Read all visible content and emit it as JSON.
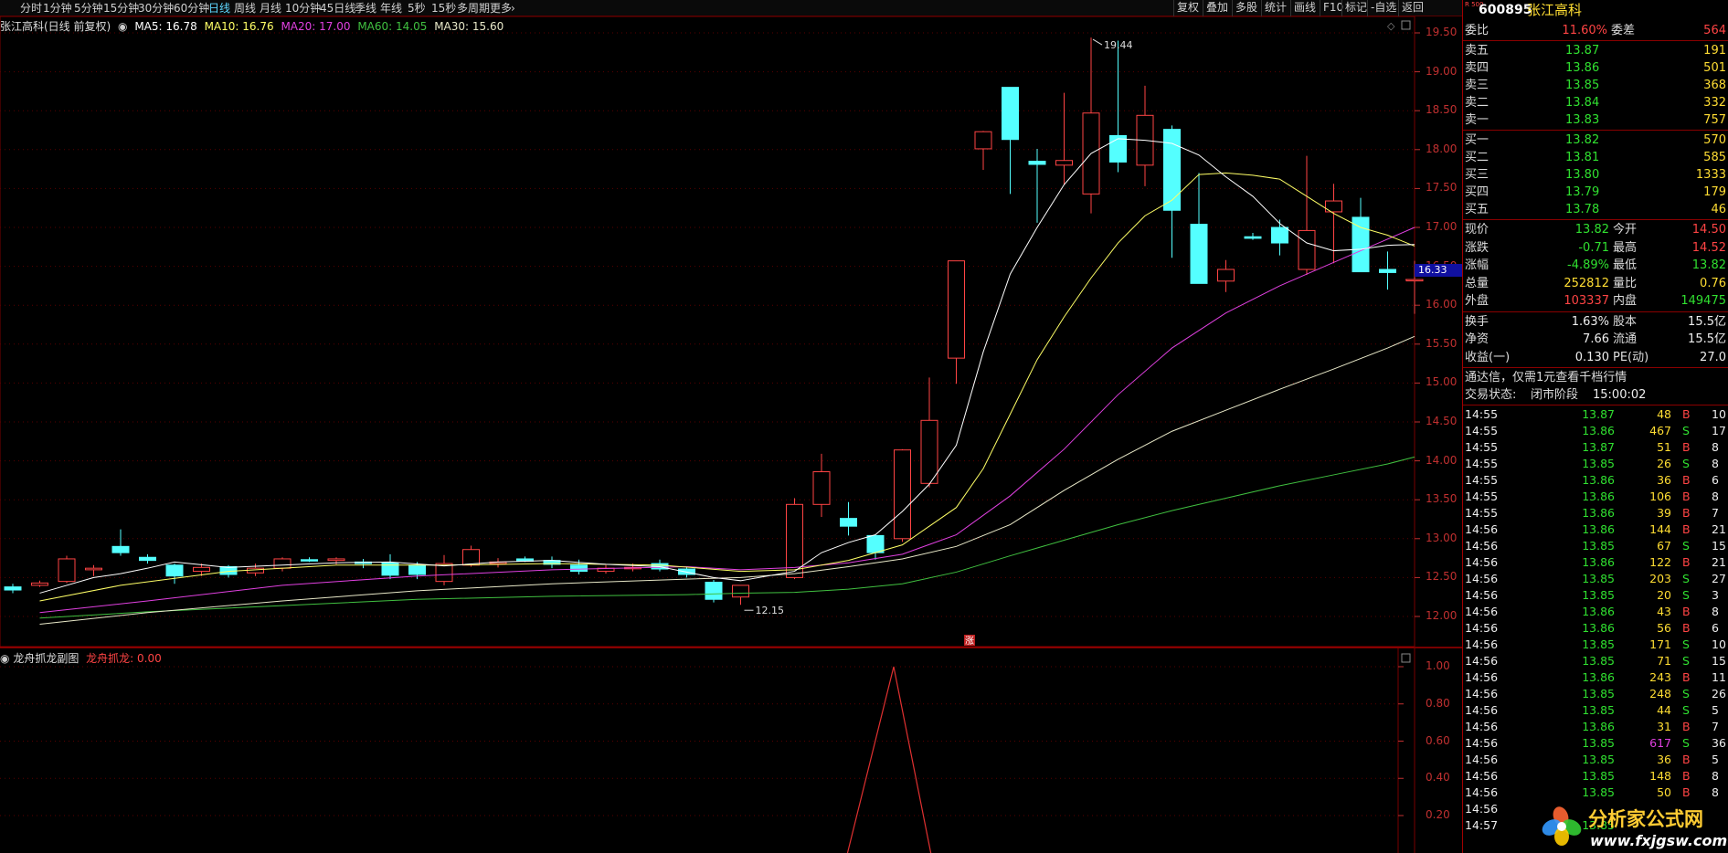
{
  "toolbar": {
    "timeframes": [
      "分时",
      "1分钟",
      "5分钟",
      "15分钟",
      "30分钟",
      "60分钟",
      "日线",
      "周线",
      "月线",
      "10分钟",
      "45日线",
      "季线",
      "年线",
      "5秒",
      "15秒",
      "多周期",
      "更多"
    ],
    "active": "日线",
    "right_buttons": [
      "复权",
      "叠加",
      "多股",
      "统计",
      "画线",
      "F10",
      "标记",
      "-自选",
      "返回"
    ]
  },
  "chart_info": {
    "title": "张江高科(日线 前复权)",
    "ma5": "MA5: 16.78",
    "ma10": "MA10: 16.76",
    "ma20": "MA20: 17.00",
    "ma60": "MA60: 14.05",
    "ma30": "MA30: 15.60",
    "high_label": "19.44",
    "low_label": "12.15",
    "current_tag": "16.33",
    "zhang_mark": "涨",
    "y_labels": [
      "19.50",
      "19.00",
      "18.50",
      "18.00",
      "17.50",
      "17.00",
      "16.50",
      "16.00",
      "15.50",
      "15.00",
      "14.50",
      "14.00",
      "13.50",
      "13.00",
      "12.50",
      "12.00"
    ],
    "colors": {
      "up": "#ff4444",
      "down": "#54ffff",
      "ma5": "#ffffff",
      "ma10": "#ffff66",
      "ma20": "#e040e0",
      "ma30": "#e8e8c8",
      "ma60": "#40c040"
    }
  },
  "sub_chart": {
    "title": "龙舟抓龙副图",
    "series_label": "龙舟抓龙: 0.00",
    "y_labels": [
      "1.00",
      "0.80",
      "0.60",
      "0.40",
      "0.20"
    ]
  },
  "chart_data": {
    "type": "candlestick",
    "ohlc": [
      [
        12.38,
        12.42,
        12.3,
        12.34
      ],
      [
        12.4,
        12.46,
        12.38,
        12.43
      ],
      [
        12.45,
        12.78,
        12.43,
        12.74
      ],
      [
        12.6,
        12.66,
        12.52,
        12.62
      ],
      [
        12.9,
        13.12,
        12.78,
        12.82
      ],
      [
        12.76,
        12.8,
        12.68,
        12.72
      ],
      [
        12.66,
        12.68,
        12.42,
        12.52
      ],
      [
        12.58,
        12.68,
        12.52,
        12.63
      ],
      [
        12.64,
        12.66,
        12.5,
        12.54
      ],
      [
        12.56,
        12.68,
        12.52,
        12.62
      ],
      [
        12.62,
        12.76,
        12.58,
        12.74
      ],
      [
        12.73,
        12.76,
        12.7,
        12.72
      ],
      [
        12.72,
        12.76,
        12.67,
        12.74
      ],
      [
        12.7,
        12.74,
        12.62,
        12.68
      ],
      [
        12.69,
        12.8,
        12.48,
        12.53
      ],
      [
        12.66,
        12.7,
        12.48,
        12.54
      ],
      [
        12.45,
        12.79,
        12.4,
        12.68
      ],
      [
        12.66,
        12.91,
        12.64,
        12.86
      ],
      [
        12.68,
        12.75,
        12.63,
        12.7
      ],
      [
        12.74,
        12.77,
        12.7,
        12.71
      ],
      [
        12.72,
        12.77,
        12.62,
        12.67
      ],
      [
        12.66,
        12.73,
        12.54,
        12.58
      ],
      [
        12.58,
        12.66,
        12.55,
        12.62
      ],
      [
        12.62,
        12.68,
        12.58,
        12.63
      ],
      [
        12.68,
        12.73,
        12.58,
        12.61
      ],
      [
        12.61,
        12.63,
        12.5,
        12.54
      ],
      [
        12.44,
        12.47,
        12.18,
        12.22
      ],
      [
        12.25,
        12.4,
        12.15,
        12.4
      ],
      [
        null,
        null,
        null,
        null
      ],
      [
        12.5,
        13.52,
        12.48,
        13.44
      ],
      [
        13.44,
        14.09,
        13.28,
        13.86
      ],
      [
        13.26,
        13.47,
        13.04,
        13.16
      ],
      [
        13.04,
        13.04,
        12.73,
        12.82
      ],
      [
        13.0,
        14.15,
        12.96,
        14.14
      ],
      [
        13.71,
        15.07,
        13.66,
        14.52
      ],
      [
        15.32,
        16.57,
        14.99,
        16.57
      ],
      [
        18.01,
        18.24,
        17.74,
        18.23
      ],
      [
        18.8,
        18.8,
        17.43,
        18.13
      ],
      [
        17.85,
        18.01,
        17.06,
        17.81
      ],
      [
        17.8,
        18.73,
        17.55,
        17.86
      ],
      [
        17.43,
        19.44,
        17.18,
        18.47
      ],
      [
        18.18,
        19.4,
        17.71,
        17.84
      ],
      [
        17.8,
        18.82,
        17.53,
        18.44
      ],
      [
        18.26,
        18.31,
        16.61,
        17.22
      ],
      [
        17.04,
        17.7,
        16.28,
        16.28
      ],
      [
        16.31,
        16.58,
        16.17,
        16.46
      ],
      [
        16.88,
        16.93,
        16.84,
        16.86
      ],
      [
        17.0,
        17.1,
        16.64,
        16.8
      ],
      [
        16.46,
        17.92,
        16.39,
        16.96
      ],
      [
        17.2,
        17.56,
        16.54,
        17.34
      ],
      [
        17.13,
        17.38,
        16.44,
        16.43
      ],
      [
        16.46,
        16.69,
        16.2,
        16.42
      ],
      [
        16.33,
        16.57,
        15.89,
        16.33
      ]
    ],
    "ma5": [
      [
        1,
        12.3
      ],
      [
        2,
        12.4
      ],
      [
        3,
        12.5
      ],
      [
        4,
        12.55
      ],
      [
        5,
        12.62
      ],
      [
        6,
        12.7
      ],
      [
        8,
        12.63
      ],
      [
        10,
        12.66
      ],
      [
        12,
        12.69
      ],
      [
        14,
        12.7
      ],
      [
        16,
        12.65
      ],
      [
        18,
        12.7
      ],
      [
        20,
        12.72
      ],
      [
        22,
        12.67
      ],
      [
        24,
        12.64
      ],
      [
        26,
        12.5
      ],
      [
        27,
        12.46
      ],
      [
        29,
        12.58
      ],
      [
        30,
        12.82
      ],
      [
        31,
        12.95
      ],
      [
        32,
        13.05
      ],
      [
        33,
        13.35
      ],
      [
        34,
        13.7
      ],
      [
        35,
        14.2
      ],
      [
        36,
        15.4
      ],
      [
        37,
        16.4
      ],
      [
        38,
        17.0
      ],
      [
        39,
        17.55
      ],
      [
        40,
        17.95
      ],
      [
        41,
        18.14
      ],
      [
        42,
        18.12
      ],
      [
        43,
        18.08
      ],
      [
        44,
        17.93
      ],
      [
        45,
        17.65
      ],
      [
        46,
        17.4
      ],
      [
        47,
        17.05
      ],
      [
        48,
        16.8
      ],
      [
        49,
        16.7
      ],
      [
        50,
        16.72
      ],
      [
        51,
        16.77
      ],
      [
        52,
        16.78
      ]
    ],
    "ma10": [
      [
        1,
        12.2
      ],
      [
        4,
        12.4
      ],
      [
        8,
        12.58
      ],
      [
        12,
        12.66
      ],
      [
        16,
        12.66
      ],
      [
        20,
        12.68
      ],
      [
        24,
        12.66
      ],
      [
        27,
        12.58
      ],
      [
        29,
        12.6
      ],
      [
        31,
        12.72
      ],
      [
        33,
        12.92
      ],
      [
        35,
        13.4
      ],
      [
        36,
        13.9
      ],
      [
        37,
        14.6
      ],
      [
        38,
        15.3
      ],
      [
        39,
        15.85
      ],
      [
        40,
        16.35
      ],
      [
        41,
        16.8
      ],
      [
        42,
        17.15
      ],
      [
        43,
        17.35
      ],
      [
        44,
        17.68
      ],
      [
        45,
        17.7
      ],
      [
        46,
        17.67
      ],
      [
        47,
        17.62
      ],
      [
        48,
        17.4
      ],
      [
        49,
        17.18
      ],
      [
        50,
        17.0
      ],
      [
        51,
        16.9
      ],
      [
        52,
        16.76
      ]
    ],
    "ma20": [
      [
        1,
        12.05
      ],
      [
        5,
        12.2
      ],
      [
        10,
        12.4
      ],
      [
        15,
        12.52
      ],
      [
        20,
        12.6
      ],
      [
        25,
        12.64
      ],
      [
        27,
        12.6
      ],
      [
        29,
        12.63
      ],
      [
        31,
        12.69
      ],
      [
        33,
        12.8
      ],
      [
        35,
        13.05
      ],
      [
        37,
        13.55
      ],
      [
        39,
        14.15
      ],
      [
        41,
        14.85
      ],
      [
        43,
        15.45
      ],
      [
        45,
        15.9
      ],
      [
        47,
        16.25
      ],
      [
        49,
        16.55
      ],
      [
        51,
        16.85
      ],
      [
        52,
        17.0
      ]
    ],
    "ma30": [
      [
        1,
        11.9
      ],
      [
        5,
        12.05
      ],
      [
        10,
        12.2
      ],
      [
        15,
        12.33
      ],
      [
        20,
        12.42
      ],
      [
        25,
        12.48
      ],
      [
        27,
        12.5
      ],
      [
        29,
        12.55
      ],
      [
        31,
        12.64
      ],
      [
        33,
        12.74
      ],
      [
        35,
        12.9
      ],
      [
        37,
        13.18
      ],
      [
        39,
        13.62
      ],
      [
        41,
        14.02
      ],
      [
        43,
        14.38
      ],
      [
        45,
        14.65
      ],
      [
        47,
        14.92
      ],
      [
        49,
        15.18
      ],
      [
        51,
        15.45
      ],
      [
        52,
        15.6
      ]
    ],
    "ma60": [
      [
        1,
        11.98
      ],
      [
        5,
        12.06
      ],
      [
        10,
        12.14
      ],
      [
        15,
        12.22
      ],
      [
        20,
        12.26
      ],
      [
        25,
        12.28
      ],
      [
        27,
        12.3
      ],
      [
        29,
        12.31
      ],
      [
        31,
        12.35
      ],
      [
        33,
        12.42
      ],
      [
        35,
        12.57
      ],
      [
        37,
        12.78
      ],
      [
        39,
        12.98
      ],
      [
        41,
        13.18
      ],
      [
        43,
        13.36
      ],
      [
        45,
        13.52
      ],
      [
        47,
        13.68
      ],
      [
        49,
        13.82
      ],
      [
        51,
        13.96
      ],
      [
        52,
        14.05
      ]
    ],
    "sub_series": [
      [
        0,
        0
      ],
      [
        31,
        0
      ],
      [
        33,
        1
      ],
      [
        35,
        0
      ],
      [
        52,
        0
      ]
    ],
    "ylim": [
      11.75,
      19.55
    ],
    "sub_ylim": [
      0,
      1.1
    ]
  },
  "right_panel": {
    "code": "600895",
    "name": "张江高科",
    "badge": "R 500",
    "weibi": {
      "label": "委比",
      "value": "11.60%",
      "label2": "委差",
      "value2": "564"
    },
    "sells": [
      {
        "label": "卖五",
        "price": "13.87",
        "vol": "191"
      },
      {
        "label": "卖四",
        "price": "13.86",
        "vol": "501"
      },
      {
        "label": "卖三",
        "price": "13.85",
        "vol": "368"
      },
      {
        "label": "卖二",
        "price": "13.84",
        "vol": "332"
      },
      {
        "label": "卖一",
        "price": "13.83",
        "vol": "757"
      }
    ],
    "buys": [
      {
        "label": "买一",
        "price": "13.82",
        "vol": "570"
      },
      {
        "label": "买二",
        "price": "13.81",
        "vol": "585"
      },
      {
        "label": "买三",
        "price": "13.80",
        "vol": "1333"
      },
      {
        "label": "买四",
        "price": "13.79",
        "vol": "179"
      },
      {
        "label": "买五",
        "price": "13.78",
        "vol": "46"
      }
    ],
    "stats1": [
      {
        "l1": "现价",
        "v1": "13.82",
        "l2": "今开",
        "v2": "14.50",
        "c1": "grn",
        "c2": "red"
      },
      {
        "l1": "涨跌",
        "v1": "-0.71",
        "l2": "最高",
        "v2": "14.52",
        "c1": "grn",
        "c2": "red"
      },
      {
        "l1": "涨幅",
        "v1": "-4.89%",
        "l2": "最低",
        "v2": "13.82",
        "c1": "grn",
        "c2": "grn"
      },
      {
        "l1": "总量",
        "v1": "252812",
        "l2": "量比",
        "v2": "0.76",
        "c1": "yel",
        "c2": "yel"
      },
      {
        "l1": "外盘",
        "v1": "103337",
        "l2": "内盘",
        "v2": "149475",
        "c1": "red",
        "c2": "grn"
      }
    ],
    "stats2": [
      {
        "l1": "换手",
        "v1": "1.63%",
        "l2": "股本",
        "v2": "15.5亿"
      },
      {
        "l1": "净资",
        "v1": "7.66",
        "l2": "流通",
        "v2": "15.5亿"
      },
      {
        "l1": "收益(一)",
        "v1": "0.130",
        "l2": "PE(动)",
        "v2": "27.0"
      }
    ],
    "notice": "通达信，仅需1元查看千档行情",
    "status_label": "交易状态:",
    "status_value": "闭市阶段",
    "status_time": "15:00:02",
    "ticks": [
      [
        "14:55",
        "13.87",
        "48",
        "B",
        "10"
      ],
      [
        "14:55",
        "13.86",
        "467",
        "S",
        "17"
      ],
      [
        "14:55",
        "13.87",
        "51",
        "B",
        "8"
      ],
      [
        "14:55",
        "13.85",
        "26",
        "S",
        "8"
      ],
      [
        "14:55",
        "13.86",
        "36",
        "B",
        "6"
      ],
      [
        "14:55",
        "13.86",
        "106",
        "B",
        "8"
      ],
      [
        "14:55",
        "13.86",
        "39",
        "B",
        "7"
      ],
      [
        "14:56",
        "13.86",
        "144",
        "B",
        "21"
      ],
      [
        "14:56",
        "13.85",
        "67",
        "S",
        "15"
      ],
      [
        "14:56",
        "13.86",
        "122",
        "B",
        "21"
      ],
      [
        "14:56",
        "13.85",
        "203",
        "S",
        "27"
      ],
      [
        "14:56",
        "13.85",
        "20",
        "S",
        "3"
      ],
      [
        "14:56",
        "13.86",
        "43",
        "B",
        "8"
      ],
      [
        "14:56",
        "13.86",
        "56",
        "B",
        "6"
      ],
      [
        "14:56",
        "13.85",
        "171",
        "S",
        "10"
      ],
      [
        "14:56",
        "13.85",
        "71",
        "S",
        "15"
      ],
      [
        "14:56",
        "13.86",
        "243",
        "B",
        "11"
      ],
      [
        "14:56",
        "13.85",
        "248",
        "S",
        "26"
      ],
      [
        "14:56",
        "13.85",
        "44",
        "S",
        "5"
      ],
      [
        "14:56",
        "13.86",
        "31",
        "B",
        "7"
      ],
      [
        "14:56",
        "13.85",
        "617",
        "S",
        "36"
      ],
      [
        "14:56",
        "13.85",
        "36",
        "B",
        "5"
      ],
      [
        "14:56",
        "13.85",
        "148",
        "B",
        "8"
      ],
      [
        "14:56",
        "13.85",
        "50",
        "B",
        "8"
      ],
      [
        "14:56",
        "",
        "",
        " ",
        ""
      ],
      [
        "14:57",
        "13.85",
        "",
        "",
        " "
      ]
    ]
  },
  "watermark": {
    "cn": "分析家公式网",
    "url": "www.fxjgsw.com"
  }
}
